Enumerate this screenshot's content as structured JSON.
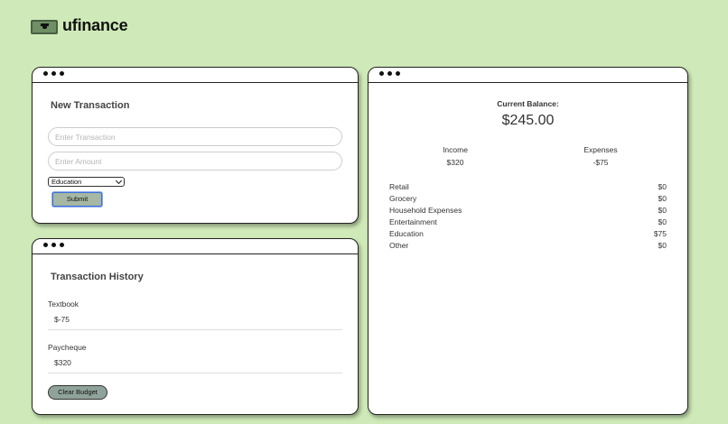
{
  "brand": {
    "name": "ufinance",
    "logo_icon": "graduation-cap-money-icon"
  },
  "new_transaction": {
    "title": "New Transaction",
    "transaction_placeholder": "Enter Transaction",
    "amount_placeholder": "Enter Amount",
    "category_selected": "Education",
    "submit_label": "Submit"
  },
  "history": {
    "title": "Transaction History",
    "items": [
      {
        "name": "Textbook",
        "amount": "$-75"
      },
      {
        "name": "Paycheque",
        "amount": "$320"
      }
    ],
    "clear_label": "Clear Budget"
  },
  "summary": {
    "balance_label": "Current Balance:",
    "balance_value": "$245.00",
    "income_label": "Income",
    "income_value": "$320",
    "expenses_label": "Expenses",
    "expenses_value": "-$75",
    "categories": [
      {
        "name": "Retail",
        "amount": "$0"
      },
      {
        "name": "Grocery",
        "amount": "$0"
      },
      {
        "name": "Household Expenses",
        "amount": "$0"
      },
      {
        "name": "Entertainment",
        "amount": "$0"
      },
      {
        "name": "Education",
        "amount": "$75"
      },
      {
        "name": "Other",
        "amount": "$0"
      }
    ]
  },
  "colors": {
    "background": "#cfeab8",
    "submit_button": "#a6b7a4",
    "clear_button": "#8fa39a"
  }
}
